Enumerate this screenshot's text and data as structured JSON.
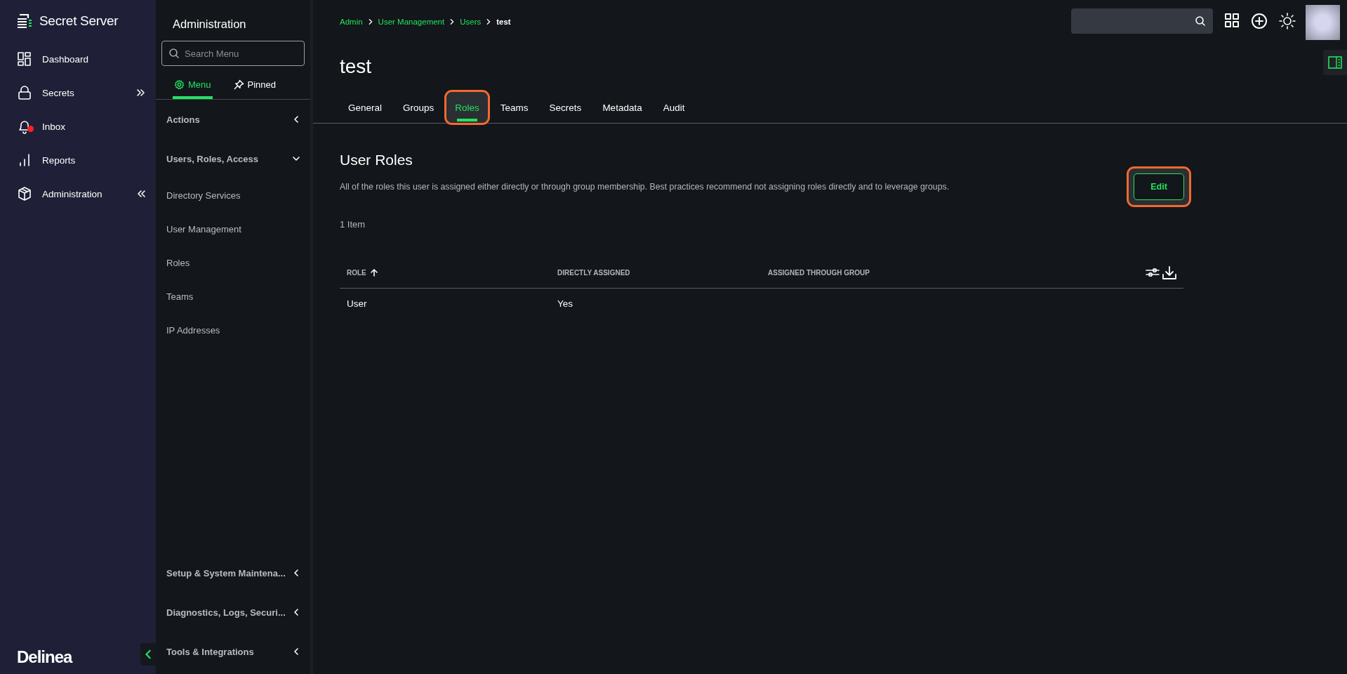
{
  "app": {
    "name": "Secret Server",
    "footer_logo": "Delinea"
  },
  "nav": [
    {
      "label": "Dashboard",
      "badge": false
    },
    {
      "label": "Secrets",
      "badge": false,
      "expanded": false
    },
    {
      "label": "Inbox",
      "badge": true
    },
    {
      "label": "Reports",
      "badge": false
    },
    {
      "label": "Administration",
      "badge": false,
      "expanded": true
    }
  ],
  "menu_panel": {
    "title": "Administration",
    "search": {
      "placeholder": "Search Menu"
    },
    "tabs": [
      {
        "label": "Menu",
        "selected": true
      },
      {
        "label": "Pinned",
        "selected": false
      }
    ],
    "sections": [
      {
        "label": "Actions",
        "expanded": false
      },
      {
        "label": "Users, Roles, Access",
        "expanded": true,
        "children": [
          {
            "label": "Directory Services"
          },
          {
            "label": "User Management"
          },
          {
            "label": "Roles"
          },
          {
            "label": "Teams"
          },
          {
            "label": "IP Addresses"
          }
        ]
      }
    ],
    "bottom_sections": [
      {
        "label": "Setup & System Maintena...",
        "expanded": false
      },
      {
        "label": "Diagnostics, Logs, Securi...",
        "expanded": false
      },
      {
        "label": "Tools & Integrations",
        "expanded": false
      }
    ]
  },
  "breadcrumb": [
    {
      "label": "Admin",
      "link": true
    },
    {
      "label": "User Management",
      "link": true
    },
    {
      "label": "Users",
      "link": true
    },
    {
      "label": "test",
      "link": false
    }
  ],
  "page_title": "test",
  "tabs": [
    {
      "label": "General",
      "selected": false,
      "highlighted": false
    },
    {
      "label": "Groups",
      "selected": false,
      "highlighted": false
    },
    {
      "label": "Roles",
      "selected": true,
      "highlighted": true
    },
    {
      "label": "Teams",
      "selected": false,
      "highlighted": false
    },
    {
      "label": "Secrets",
      "selected": false,
      "highlighted": false
    },
    {
      "label": "Metadata",
      "selected": false,
      "highlighted": false
    },
    {
      "label": "Audit",
      "selected": false,
      "highlighted": false
    }
  ],
  "section": {
    "title": "User Roles",
    "description": "All of the roles this user is assigned either directly or through group membership. Best practices recommend not assigning roles directly and to leverage groups.",
    "edit_button": {
      "label": "Edit",
      "highlighted": true
    },
    "count": "1 Item"
  },
  "table": {
    "columns": [
      {
        "label": "ROLE",
        "sorted": true
      },
      {
        "label": "DIRECTLY ASSIGNED",
        "sorted": false
      },
      {
        "label": "ASSIGNED THROUGH GROUP",
        "sorted": false
      }
    ],
    "rows": [
      [
        "User",
        "Yes",
        ""
      ]
    ]
  }
}
